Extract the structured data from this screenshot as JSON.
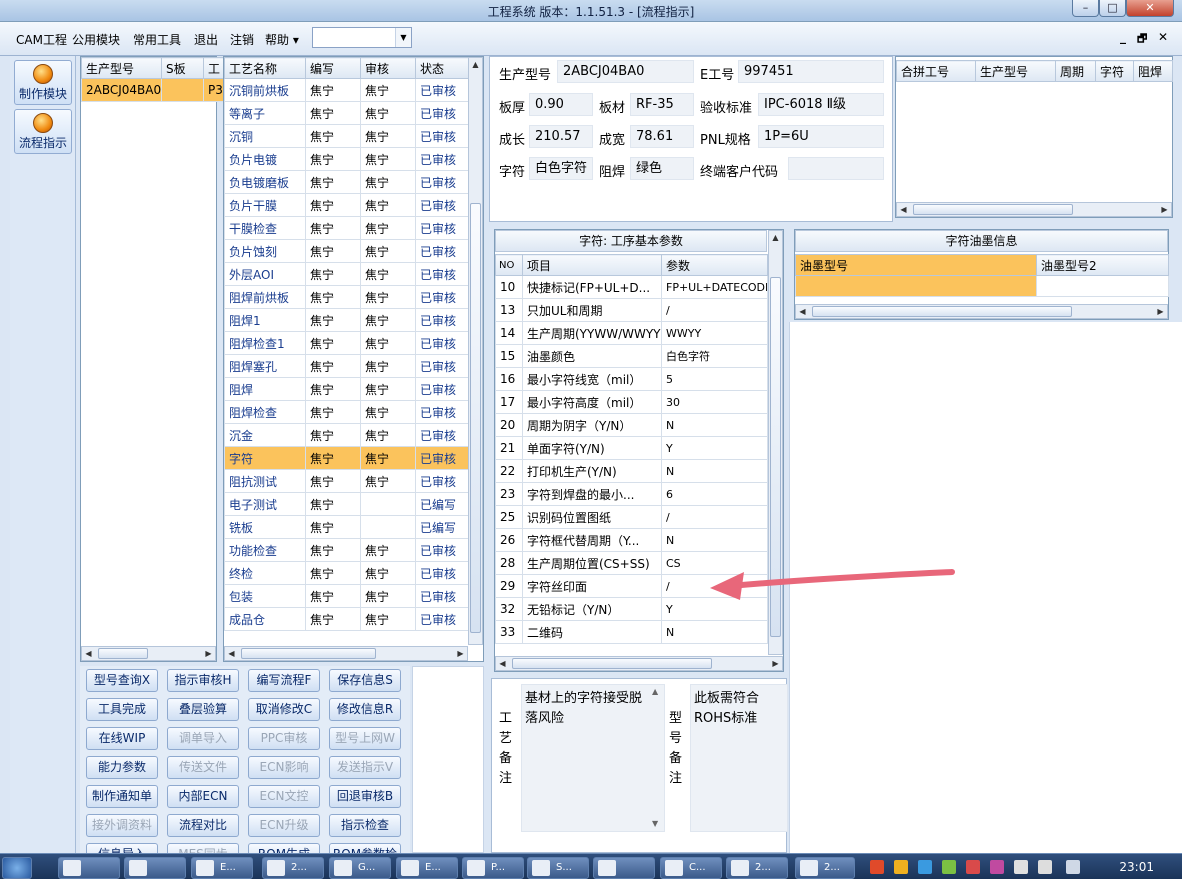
{
  "window": {
    "title": "工程系统   版本：1.1.51.3 - [流程指示]",
    "minimize": "–",
    "maximize": "□",
    "close": "✕"
  },
  "menu": {
    "items": [
      "CAM工程",
      "公用模块",
      "常用工具",
      "退出",
      "注销",
      "帮助 ▾"
    ],
    "combo_value": "",
    "mdi": [
      "_",
      "🗗",
      "✕"
    ]
  },
  "tools": [
    {
      "label": "制作模块"
    },
    {
      "label": "流程指示"
    }
  ],
  "models": {
    "headers": [
      "生产型号",
      "S板",
      "工"
    ],
    "rows": [
      [
        "2ABCJ04BA0",
        "",
        "P3"
      ]
    ]
  },
  "process": {
    "headers": [
      "工艺名称",
      "编写",
      "审核",
      "状态"
    ],
    "rows": [
      [
        "沉铜前烘板",
        "焦宁",
        "焦宁",
        "已审核"
      ],
      [
        "等离子",
        "焦宁",
        "焦宁",
        "已审核"
      ],
      [
        "沉铜",
        "焦宁",
        "焦宁",
        "已审核"
      ],
      [
        "负片电镀",
        "焦宁",
        "焦宁",
        "已审核"
      ],
      [
        "负电镀磨板",
        "焦宁",
        "焦宁",
        "已审核"
      ],
      [
        "负片干膜",
        "焦宁",
        "焦宁",
        "已审核"
      ],
      [
        "干膜检查",
        "焦宁",
        "焦宁",
        "已审核"
      ],
      [
        "负片蚀刻",
        "焦宁",
        "焦宁",
        "已审核"
      ],
      [
        "外层AOI",
        "焦宁",
        "焦宁",
        "已审核"
      ],
      [
        "阻焊前烘板",
        "焦宁",
        "焦宁",
        "已审核"
      ],
      [
        "阻焊1",
        "焦宁",
        "焦宁",
        "已审核"
      ],
      [
        "阻焊检查1",
        "焦宁",
        "焦宁",
        "已审核"
      ],
      [
        "阻焊塞孔",
        "焦宁",
        "焦宁",
        "已审核"
      ],
      [
        "阻焊",
        "焦宁",
        "焦宁",
        "已审核"
      ],
      [
        "阻焊检查",
        "焦宁",
        "焦宁",
        "已审核"
      ],
      [
        "沉金",
        "焦宁",
        "焦宁",
        "已审核"
      ],
      [
        "字符",
        "焦宁",
        "焦宁",
        "已审核"
      ],
      [
        "阻抗测试",
        "焦宁",
        "焦宁",
        "已审核"
      ],
      [
        "电子测试",
        "焦宁",
        "",
        "已编写"
      ],
      [
        "铣板",
        "焦宁",
        "",
        "已编写"
      ],
      [
        "功能检查",
        "焦宁",
        "焦宁",
        "已审核"
      ],
      [
        "终检",
        "焦宁",
        "焦宁",
        "已审核"
      ],
      [
        "包装",
        "焦宁",
        "焦宁",
        "已审核"
      ],
      [
        "成品仓",
        "焦宁",
        "焦宁",
        "已审核"
      ]
    ],
    "selected_index": 16
  },
  "actions": [
    [
      "型号查询X",
      "指示审核H",
      "编写流程F",
      "保存信息S"
    ],
    [
      "工具完成",
      "叠层验算",
      "取消修改C",
      "修改信息R"
    ],
    [
      "在线WIP",
      "调单导入",
      "PPC审核",
      "型号上网W"
    ],
    [
      "能力参数",
      "传送文件",
      "ECN影响",
      "发送指示V"
    ],
    [
      "制作通知单",
      "内部ECN",
      "ECN文控",
      "回退审核B"
    ],
    [
      "接外调资料",
      "流程对比",
      "ECN升级",
      "指示检查"
    ],
    [
      "信息导入",
      "MES同步",
      "ROM生成",
      "ROM参数检查"
    ]
  ],
  "info": {
    "labels": {
      "model": "生产型号",
      "ejob": "E工号",
      "thick": "板厚",
      "material": "板材",
      "standard": "验收标准",
      "len": "成长",
      "wid": "成宽",
      "pnl": "PNL规格",
      "char": "字符",
      "solder": "阻焊",
      "customer": "终端客户代码"
    },
    "model": "2ABCJ04BA0",
    "ejob": "997451",
    "thick": "0.90",
    "material": "RF-35",
    "standard": "IPC-6018 Ⅱ级",
    "len": "210.57",
    "wid": "78.61",
    "pnl": "1P=6U",
    "char": "白色字符",
    "solder": "绿色",
    "customer": ""
  },
  "merge": {
    "headers": [
      "合拼工号",
      "生产型号",
      "周期",
      "字符",
      "阻焊"
    ]
  },
  "params": {
    "title": "字符: 工序基本参数",
    "headers": [
      "NO",
      "项目",
      "参数"
    ],
    "rows": [
      [
        "10",
        "快捷标记(FP+UL+D...",
        "FP+UL+DATECODE"
      ],
      [
        "13",
        "只加UL和周期",
        "/"
      ],
      [
        "14",
        "生产周期(YYWW/WWYY)",
        "WWYY"
      ],
      [
        "15",
        "油墨颜色",
        "白色字符"
      ],
      [
        "16",
        "最小字符线宽（mil）",
        "5"
      ],
      [
        "17",
        "最小字符高度（mil）",
        "30"
      ],
      [
        "20",
        "周期为阴字（Y/N）",
        "N"
      ],
      [
        "21",
        "单面字符(Y/N)",
        "Y"
      ],
      [
        "22",
        "打印机生产(Y/N)",
        "N"
      ],
      [
        "23",
        "字符到焊盘的最小...",
        "6"
      ],
      [
        "25",
        "识别码位置图纸",
        "/"
      ],
      [
        "26",
        "字符框代替周期（Y...",
        "N"
      ],
      [
        "28",
        "生产周期位置(CS+SS)",
        "CS"
      ],
      [
        "29",
        "字符丝印面",
        "/"
      ],
      [
        "32",
        "无铅标记（Y/N）",
        "Y"
      ],
      [
        "33",
        "二维码",
        "N"
      ]
    ]
  },
  "ink": {
    "title": "字符油墨信息",
    "headers": [
      "油墨型号",
      "油墨型号2"
    ]
  },
  "notes": {
    "process_label": [
      "工",
      "艺",
      "备",
      "注"
    ],
    "process_text": "基材上的字符接受脱落风险",
    "model_label": [
      "型",
      "号",
      "备",
      "注"
    ],
    "model_text": "此板需符合ROHS标准"
  },
  "taskbar": {
    "items": [
      "",
      "",
      "E...",
      "2...",
      "G...",
      "E...",
      "P...",
      "S...",
      "",
      "C...",
      "2...",
      "2..."
    ],
    "time": "23:01"
  },
  "colors": {
    "selected_row": "#fbc35c",
    "link_blue": "#1a3d8f",
    "arrow": "#e8677a"
  }
}
